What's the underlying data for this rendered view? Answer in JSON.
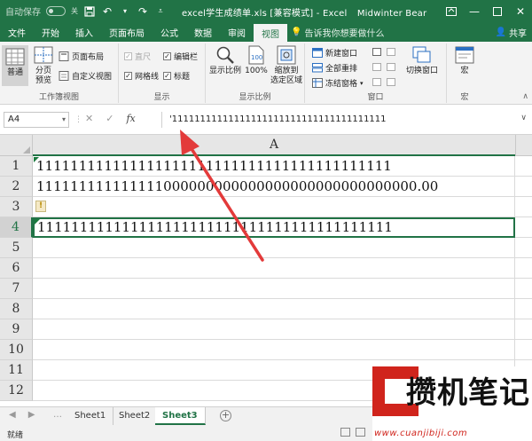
{
  "titlebar": {
    "autosave_label": "自动保存",
    "autosave_state": "关",
    "title": "excel学生成绩单.xls  [兼容模式] - Excel",
    "user": "Midwinter Bear"
  },
  "tabs": [
    "文件",
    "开始",
    "插入",
    "页面布局",
    "公式",
    "数据",
    "审阅",
    "视图"
  ],
  "active_tab": "视图",
  "tellme": "告诉我你想要做什么",
  "share": "共享",
  "ribbon": {
    "workbook_views": {
      "label": "工作簿视图",
      "normal": "普通",
      "page_break": "分页\n预览",
      "page_layout": "页面布局",
      "custom_views": "自定义视图"
    },
    "show": {
      "label": "显示",
      "ruler": "直尺",
      "gridlines": "网格线",
      "formula_bar": "编辑栏",
      "headings": "标题"
    },
    "zoom": {
      "label": "显示比例",
      "zoom": "显示比例",
      "hundred": "100%",
      "zoom_selection": "缩放到\n选定区域"
    },
    "window": {
      "label": "窗口",
      "new_window": "新建窗口",
      "arrange_all": "全部重排",
      "freeze_panes": "冻结窗格",
      "switch_windows": "切换窗口"
    },
    "macros": {
      "label": "宏",
      "macros": "宏"
    }
  },
  "formula_bar": {
    "name_box": "A4",
    "cancel": "✕",
    "enter": "✓",
    "fx": "fx",
    "content": "'11111111111111111111111111111111111111"
  },
  "grid": {
    "column": "A",
    "rows": [
      {
        "num": "1",
        "value": "111111111111111111111111111111111111111111"
      },
      {
        "num": "2",
        "value": "111111111111111000000000000000000000000000000.00"
      },
      {
        "num": "3",
        "value": ""
      },
      {
        "num": "4",
        "value": "111111111111111111111111111111111111111111"
      },
      {
        "num": "5",
        "value": ""
      },
      {
        "num": "6",
        "value": ""
      },
      {
        "num": "7",
        "value": ""
      },
      {
        "num": "8",
        "value": ""
      },
      {
        "num": "9",
        "value": ""
      },
      {
        "num": "10",
        "value": ""
      },
      {
        "num": "11",
        "value": ""
      },
      {
        "num": "12",
        "value": ""
      }
    ]
  },
  "sheets": [
    "Sheet1",
    "Sheet2",
    "Sheet3"
  ],
  "active_sheet": "Sheet3",
  "status": "就绪",
  "watermark": {
    "title": "攒机笔记",
    "url": "www.cuanjibiji.com"
  },
  "colors": {
    "excel_green": "#217346",
    "arrow": "#e33a3a",
    "watermark_red": "#d0241c"
  }
}
